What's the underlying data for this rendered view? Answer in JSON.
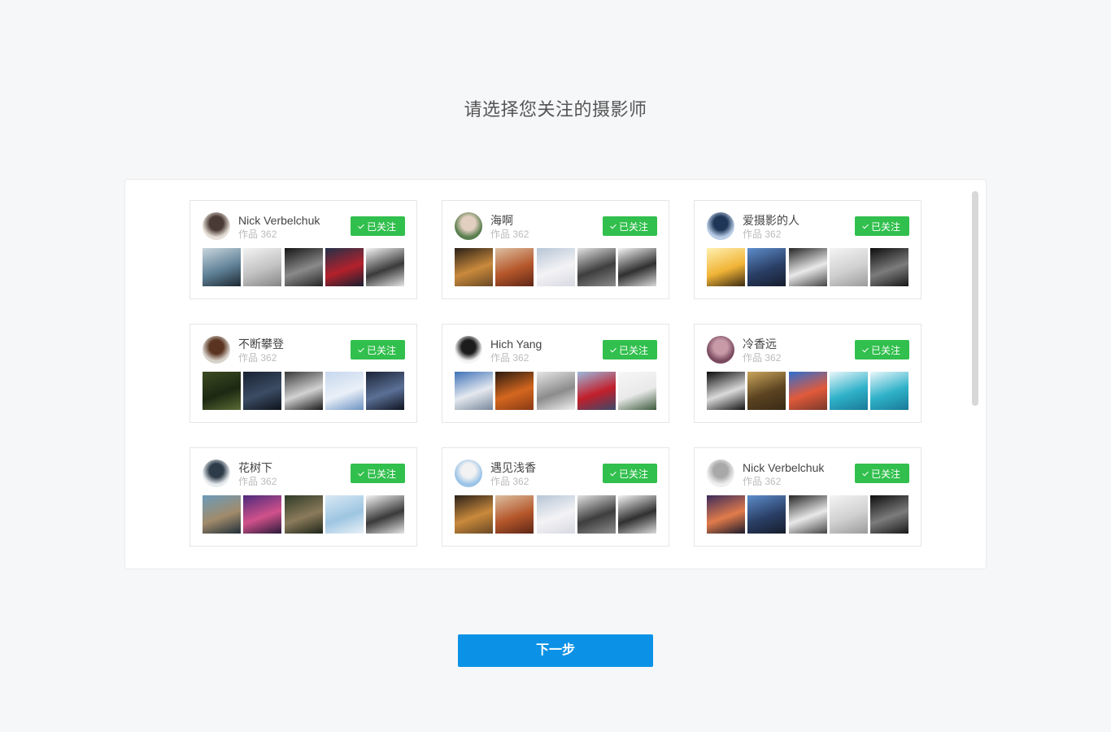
{
  "page": {
    "title": "请选择您关注的摄影师",
    "next_button_label": "下一步"
  },
  "colors": {
    "background": "#f6f7f9",
    "follow_button": "#31bf4d",
    "next_button": "#0b92e6",
    "title_text": "#555555"
  },
  "icons": {
    "follow_button_icon": "check-icon"
  },
  "photographers": [
    {
      "name": "Nick Verbelchuk",
      "works_label": "作品",
      "works_count": 362,
      "follow_label": "已关注"
    },
    {
      "name": "海啊",
      "works_label": "作品",
      "works_count": 362,
      "follow_label": "已关注"
    },
    {
      "name": "爱摄影的人",
      "works_label": "作品",
      "works_count": 362,
      "follow_label": "已关注"
    },
    {
      "name": "不断攀登",
      "works_label": "作品",
      "works_count": 362,
      "follow_label": "已关注"
    },
    {
      "name": "Hich Yang",
      "works_label": "作品",
      "works_count": 362,
      "follow_label": "已关注"
    },
    {
      "name": "冷香远",
      "works_label": "作品",
      "works_count": 362,
      "follow_label": "已关注"
    },
    {
      "name": "花树下",
      "works_label": "作品",
      "works_count": 362,
      "follow_label": "已关注"
    },
    {
      "name": "遇见浅香",
      "works_label": "作品",
      "works_count": 362,
      "follow_label": "已关注"
    },
    {
      "name": "Nick Verbelchuk",
      "works_label": "作品",
      "works_count": 362,
      "follow_label": "已关注"
    }
  ]
}
